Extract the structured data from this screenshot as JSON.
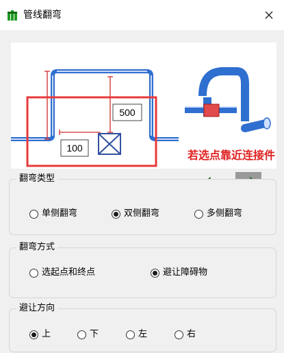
{
  "window": {
    "title": "管线翻弯"
  },
  "preview": {
    "labels": {
      "dim_vertical": "500",
      "dim_horizontal": "100",
      "hint": "若选点靠近连接件"
    },
    "colors": {
      "pipe": "#2f6fd0",
      "dimension": "#d02a2a",
      "highlight": "#e8393b",
      "hint_text": "#e02020"
    }
  },
  "nav": {
    "arrow_color": "#1e9a22"
  },
  "groups": {
    "bend_type": {
      "title": "翻弯类型",
      "options": [
        {
          "label": "单侧翻弯",
          "selected": false
        },
        {
          "label": "双侧翻弯",
          "selected": true
        },
        {
          "label": "多侧翻弯",
          "selected": false
        }
      ]
    },
    "bend_method": {
      "title": "翻弯方式",
      "options": [
        {
          "label": "选起点和终点",
          "selected": false
        },
        {
          "label": "避让障碍物",
          "selected": true
        }
      ]
    },
    "avoid_direction": {
      "title": "避让方向",
      "options": [
        {
          "label": "上",
          "selected": true
        },
        {
          "label": "下",
          "selected": false
        },
        {
          "label": "左",
          "selected": false
        },
        {
          "label": "右",
          "selected": false
        }
      ]
    }
  }
}
